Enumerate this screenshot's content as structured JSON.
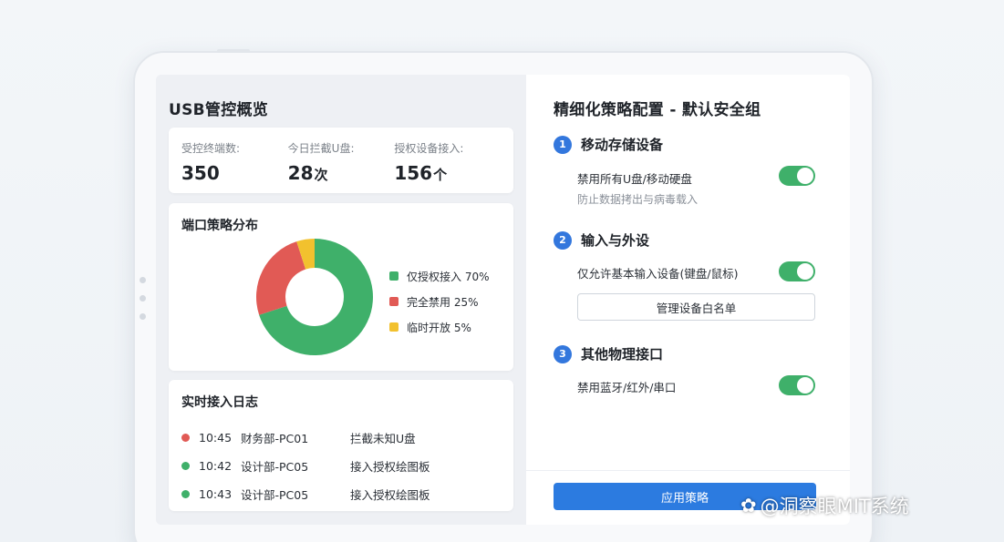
{
  "overview": {
    "title": "USB管控概览",
    "stats": [
      {
        "label": "受控终端数:",
        "value": "350",
        "unit": ""
      },
      {
        "label": "今日拦截U盘:",
        "value": "28",
        "unit": "次"
      },
      {
        "label": "授权设备接入:",
        "value": "156",
        "unit": "个"
      }
    ]
  },
  "distribution": {
    "title": "端口策略分布",
    "chart_data": {
      "type": "pie",
      "categories": [
        "仅授权接入",
        "完全禁用",
        "临时开放"
      ],
      "values": [
        70,
        25,
        5
      ],
      "colors": [
        "#3fb06a",
        "#e15a55",
        "#f2c12e"
      ]
    },
    "legend": [
      {
        "label": "仅授权接入 70%",
        "color": "#3fb06a"
      },
      {
        "label": "完全禁用 25%",
        "color": "#e15a55"
      },
      {
        "label": "临时开放 5%",
        "color": "#f2c12e"
      }
    ]
  },
  "log": {
    "title": "实时接入日志",
    "rows": [
      {
        "time": "10:45",
        "dept": "财务部-PC01",
        "event": "拦截未知U盘",
        "status_color": "#e15a55"
      },
      {
        "time": "10:42",
        "dept": "设计部-PC05",
        "event": "接入授权绘图板",
        "status_color": "#3fb06a"
      },
      {
        "time": "10:43",
        "dept": "设计部-PC05",
        "event": "接入授权绘图板",
        "status_color": "#3fb06a"
      }
    ]
  },
  "policy": {
    "title": "精细化策略配置 - 默认安全组",
    "sections": [
      {
        "num": "1",
        "title": "移动存储设备",
        "toggle_label": "禁用所有U盘/移动硬盘",
        "desc": "防止数据拷出与病毒载入",
        "enabled": true
      },
      {
        "num": "2",
        "title": "输入与外设",
        "toggle_label": "仅允许基本输入设备(键盘/鼠标)",
        "button": "管理设备白名单",
        "enabled": true
      },
      {
        "num": "3",
        "title": "其他物理接口",
        "toggle_label": "禁用蓝牙/红外/串口",
        "enabled": true
      }
    ],
    "apply_label": "应用策略"
  },
  "watermark": {
    "logo": "✿",
    "text": "@洞察眼MIT系统"
  },
  "colors": {
    "accent": "#2c7be0",
    "on": "#3fb06a",
    "block": "#e15a55",
    "temp": "#f2c12e"
  }
}
